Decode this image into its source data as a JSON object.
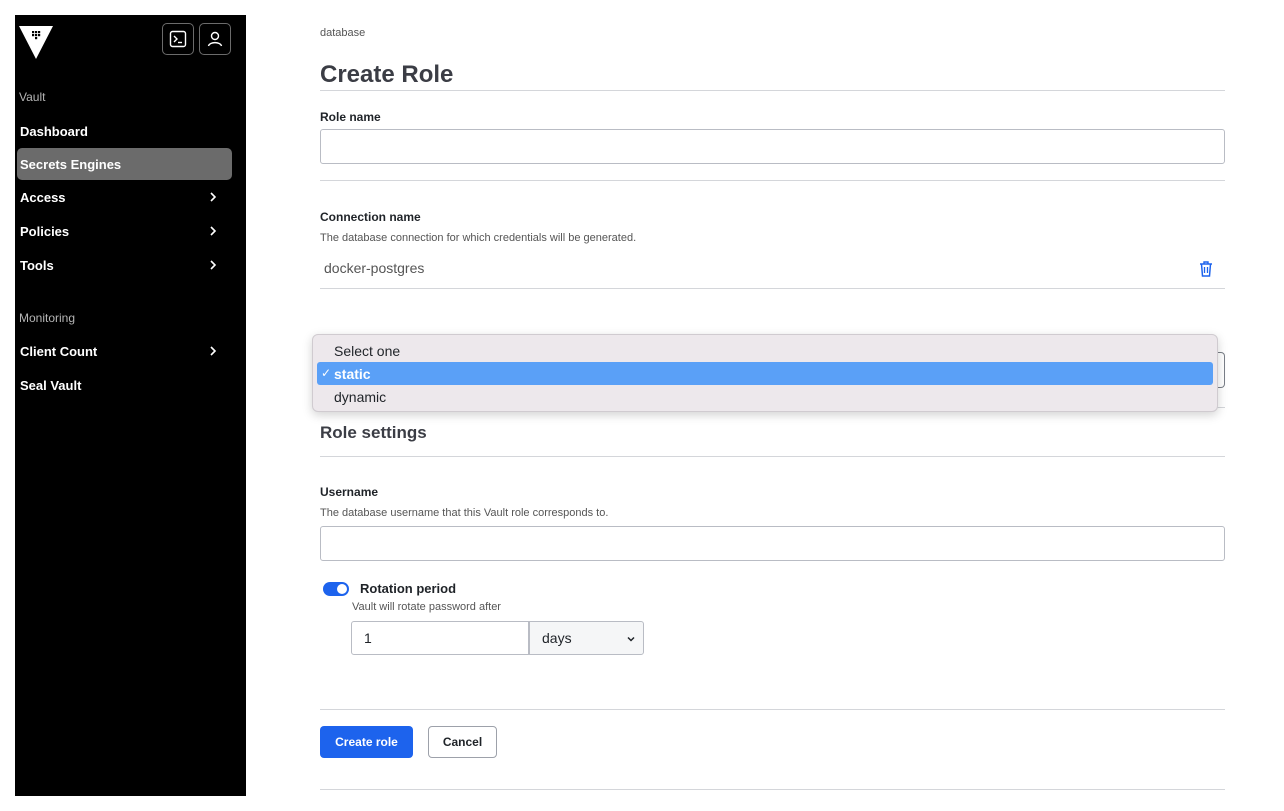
{
  "sidebar": {
    "section_vault": "Vault",
    "section_monitoring": "Monitoring",
    "items": [
      {
        "label": "Dashboard"
      },
      {
        "label": "Secrets Engines"
      },
      {
        "label": "Access"
      },
      {
        "label": "Policies"
      },
      {
        "label": "Tools"
      },
      {
        "label": "Client Count"
      },
      {
        "label": "Seal Vault"
      }
    ]
  },
  "breadcrumb": "database",
  "page_title": "Create Role",
  "form": {
    "role_name_label": "Role name",
    "role_name_value": "",
    "connection_label": "Connection name",
    "connection_help": "The database connection for which credentials will be generated.",
    "connection_value": "docker-postgres",
    "type_options": [
      "Select one",
      "static",
      "dynamic"
    ],
    "type_selected": "static",
    "role_settings_title": "Role settings",
    "username_label": "Username",
    "username_help": "The database username that this Vault role corresponds to.",
    "username_value": "",
    "rotation_label": "Rotation period",
    "rotation_help": "Vault will rotate password after",
    "rotation_value": "1",
    "rotation_unit": "days",
    "create_button": "Create role",
    "cancel_button": "Cancel"
  },
  "colors": {
    "sidebar_bg": "#000000",
    "accent": "#1d63ed",
    "dropdown_highlight": "#5aa0f7"
  }
}
